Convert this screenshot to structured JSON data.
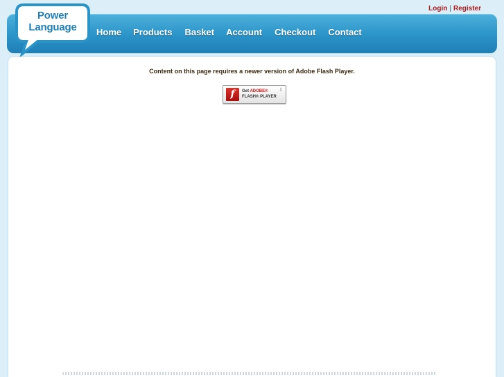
{
  "auth": {
    "login": "Login",
    "separator": "|",
    "register": "Register"
  },
  "logo": {
    "line1": "Power",
    "line2": "Language"
  },
  "nav": {
    "items": [
      {
        "label": "Home"
      },
      {
        "label": "Products"
      },
      {
        "label": "Basket"
      },
      {
        "label": "Account"
      },
      {
        "label": "Checkout"
      },
      {
        "label": "Contact"
      }
    ]
  },
  "content": {
    "flash_message": "Content on this page requires a newer version of Adobe Flash Player.",
    "flash_button": {
      "logo": "f",
      "get": "Get",
      "adobe": "ADOBE®",
      "player": "FLASH® PLAYER"
    }
  },
  "colors": {
    "background": "#dceff9",
    "header": "#2a93c8",
    "auth_link": "#b01a1a",
    "logo_blue": "#1d7fb6"
  }
}
